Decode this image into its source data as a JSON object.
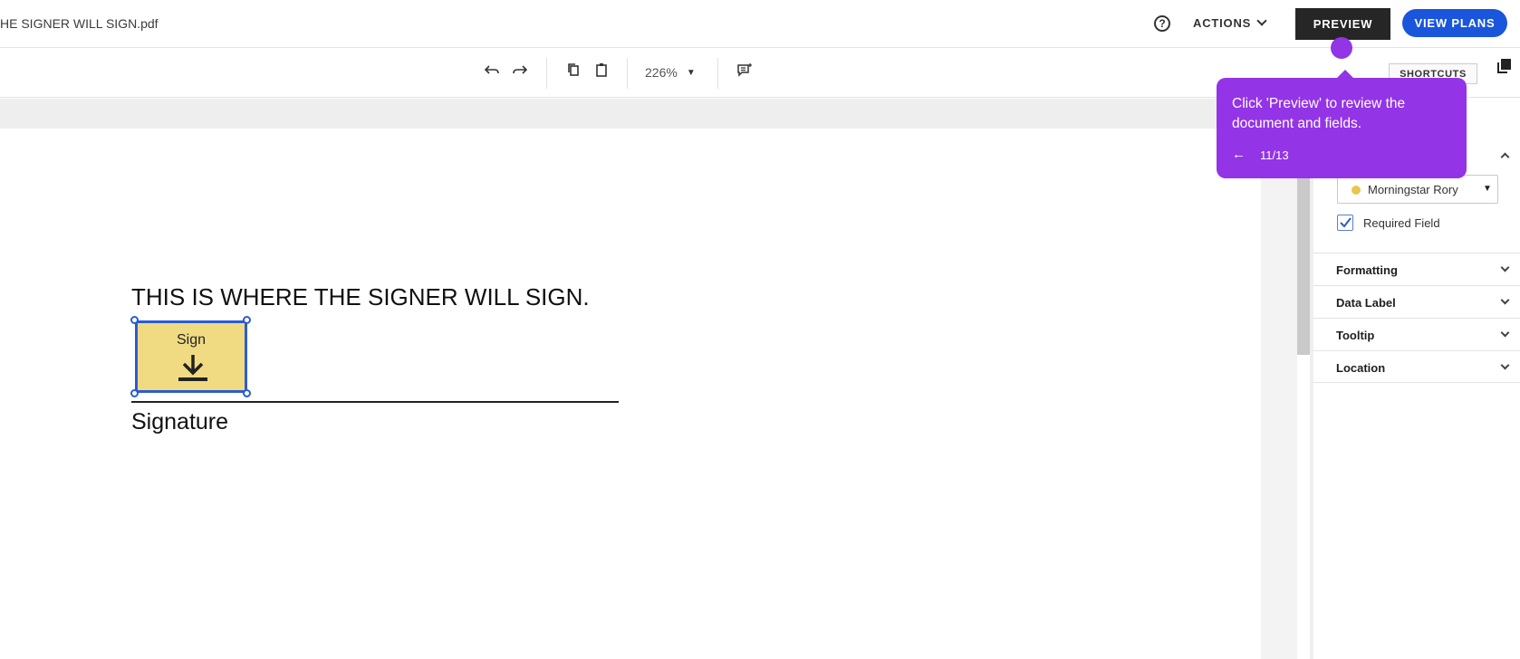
{
  "header": {
    "doc_title": "HE SIGNER WILL SIGN.pdf",
    "help_icon": "help-circle-icon",
    "actions_label": "ACTIONS",
    "preview_label": "PREVIEW",
    "view_plans_label": "VIEW PLANS"
  },
  "toolbar": {
    "icons": [
      "undo-icon",
      "redo-icon",
      "copy-icon",
      "paste-icon",
      "comment-icon"
    ],
    "zoom_value": "226%",
    "shortcuts_label": "SHORTCUTS"
  },
  "document": {
    "heading": "THIS IS WHERE THE SIGNER WILL SIGN.",
    "sign_field_label": "Sign",
    "signature_label": "Signature"
  },
  "panel": {
    "signer_name": "Morningstar Rory",
    "signer_color": "#e9c64a",
    "required_label": "Required Field",
    "required_checked": true,
    "sections": [
      {
        "label": "Formatting"
      },
      {
        "label": "Data Label"
      },
      {
        "label": "Tooltip"
      },
      {
        "label": "Location"
      }
    ]
  },
  "tooltip": {
    "message": "Click 'Preview' to review the document and fields.",
    "back_arrow": "←",
    "step": "11/13"
  },
  "colors": {
    "accent_purple": "#9334e6",
    "brand_blue": "#1a56db",
    "field_yellow": "#f0db82"
  }
}
